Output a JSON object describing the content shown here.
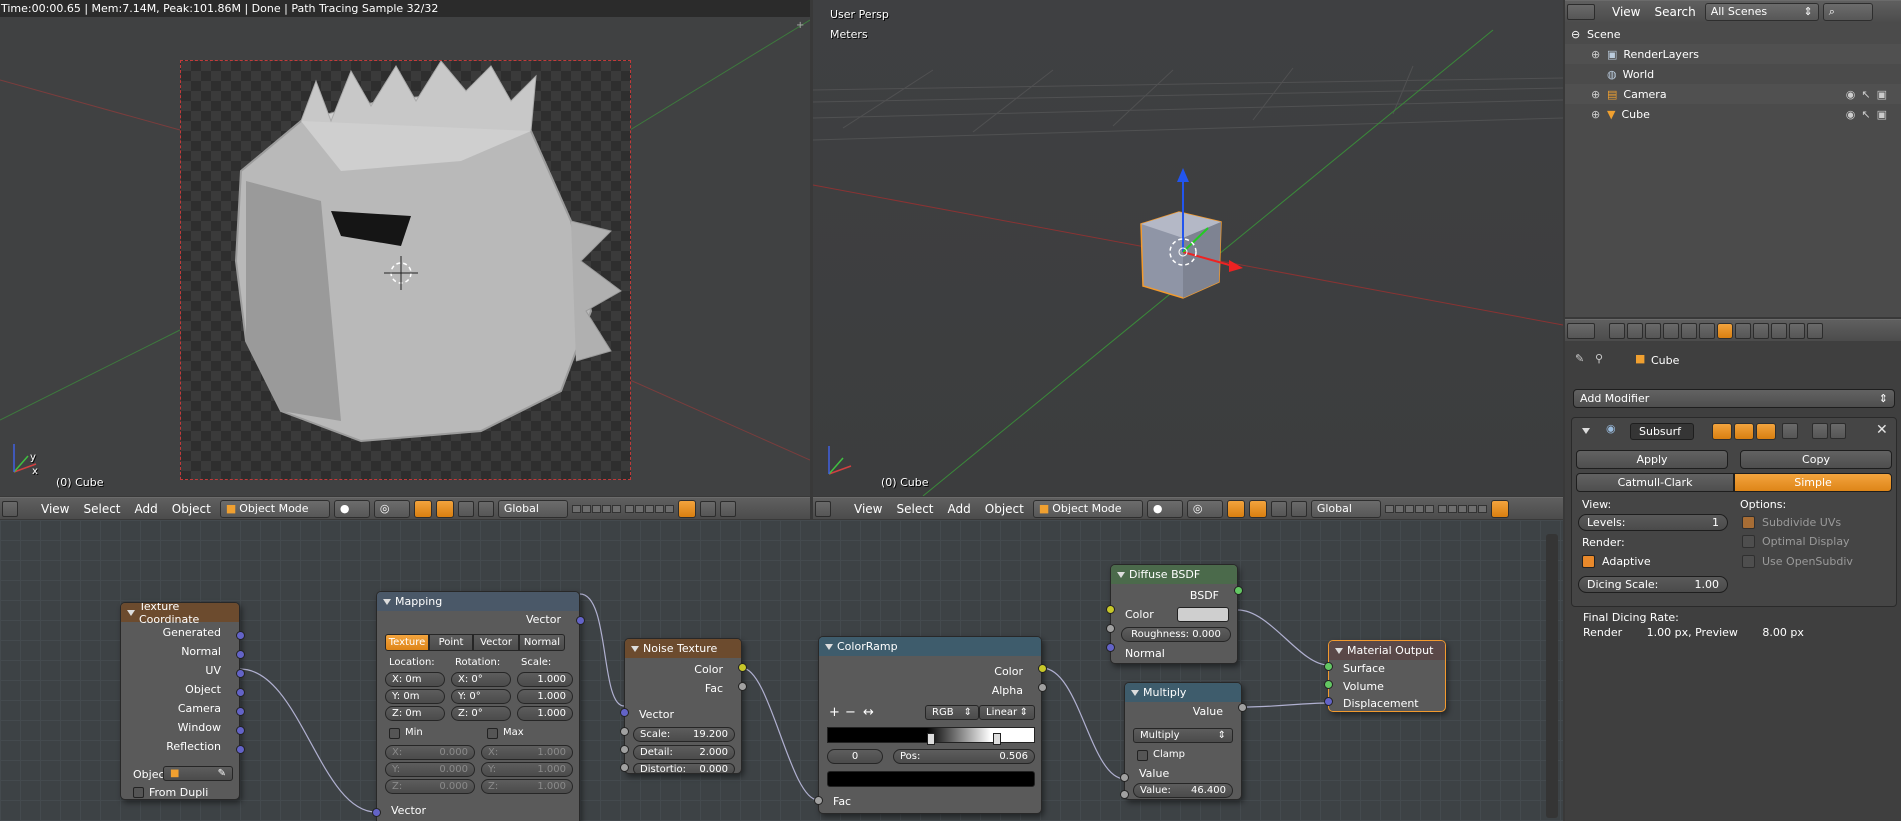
{
  "render_view": {
    "status": "Time:00:00.65 | Mem:7.14M, Peak:101.86M | Done | Path Tracing Sample 32/32",
    "object_label": "(0) Cube",
    "axis_y": "y",
    "axis_x": "x"
  },
  "viewport_3d": {
    "persp_label": "User Persp",
    "units_label": "Meters",
    "object_label": "(0) Cube"
  },
  "header_left": {
    "menu": [
      "View",
      "Select",
      "Add",
      "Object"
    ],
    "mode": "Object Mode",
    "orientation": "Global"
  },
  "header_right": {
    "menu": [
      "View",
      "Select",
      "Add",
      "Object"
    ],
    "mode": "Object Mode",
    "orientation": "Global"
  },
  "outliner": {
    "menu": [
      "View",
      "Search"
    ],
    "scene_filter": "All Scenes",
    "items": [
      "Scene",
      "RenderLayers",
      "World",
      "Camera",
      "Cube"
    ]
  },
  "properties": {
    "breadcrumb_object": "Cube",
    "add_modifier": "Add Modifier",
    "modifier_name": "Subsurf",
    "apply": "Apply",
    "copy": "Copy",
    "subdiv_types": [
      "Catmull-Clark",
      "Simple"
    ],
    "view_label": "View:",
    "levels_label": "Levels:",
    "levels_value": "1",
    "render_label": "Render:",
    "adaptive_label": "Adaptive",
    "dicing_label": "Dicing Scale:",
    "dicing_value": "1.00",
    "final_rate_label": "Final Dicing Rate:",
    "final_rate_value": "Render       1.00 px, Preview       8.00 px",
    "options_label": "Options:",
    "opt_subdivide_uvs": "Subdivide UVs",
    "opt_optimal_display": "Optimal Display",
    "opt_opensubdiv": "Use OpenSubdiv"
  },
  "nodes": {
    "texcoord": {
      "title": "Texture Coordinate",
      "outputs": [
        "Generated",
        "Normal",
        "UV",
        "Object",
        "Camera",
        "Window",
        "Reflection"
      ],
      "object_label": "Objec",
      "from_dupli": "From Dupli"
    },
    "mapping": {
      "title": "Mapping",
      "out_vector": "Vector",
      "tabs": [
        "Texture",
        "Point",
        "Vector",
        "Normal"
      ],
      "location_label": "Location:",
      "rotation_label": "Rotation:",
      "scale_label": "Scale:",
      "loc": [
        "X: 0m",
        "Y: 0m",
        "Z: 0m"
      ],
      "rot": [
        "X:  0°",
        "Y:  0°",
        "Z:  0°"
      ],
      "scl": [
        "1.000",
        "1.000",
        "1.000"
      ],
      "min_label": "Min",
      "max_label": "Max",
      "min": [
        "X:",
        "0.000",
        "Y:",
        "0.000",
        "Z:",
        "0.000"
      ],
      "max": [
        "X:",
        "1.000",
        "Y:",
        "1.000",
        "Z:",
        "1.000"
      ],
      "in_vector": "Vector"
    },
    "noise": {
      "title": "Noise Texture",
      "out_color": "Color",
      "out_fac": "Fac",
      "in_vector": "Vector",
      "scale_label": "Scale:",
      "scale_value": "19.200",
      "detail_label": "Detail:",
      "detail_value": "2.000",
      "distortion_label": "Distortio:",
      "distortion_value": "0.000"
    },
    "colorramp": {
      "title": "ColorRamp",
      "out_color": "Color",
      "out_alpha": "Alpha",
      "color_mode": "RGB",
      "interp": "Linear",
      "index": "0",
      "pos_label": "Pos:",
      "pos_value": "0.506",
      "in_fac": "Fac",
      "tools": [
        "+",
        "−",
        "↔"
      ]
    },
    "diffuse": {
      "title": "Diffuse BSDF",
      "out_bsdf": "BSDF",
      "color_label": "Color",
      "roughness": "Roughness: 0.000",
      "normal_label": "Normal"
    },
    "multiply": {
      "title": "Multiply",
      "out_value": "Value",
      "operation": "Multiply",
      "clamp_label": "Clamp",
      "in_value": "Value",
      "value_label": "Value:",
      "value": "46.400"
    },
    "output": {
      "title": "Material Output",
      "inputs": [
        "Surface",
        "Volume",
        "Displacement"
      ]
    }
  },
  "colors": {
    "accent": "#e9892b",
    "selected_outline": "#f29a2e",
    "node_header_shader": "#4b6a4b",
    "node_header_texture": "#6c4b2e",
    "node_header_converter": "#3e5c6c"
  }
}
